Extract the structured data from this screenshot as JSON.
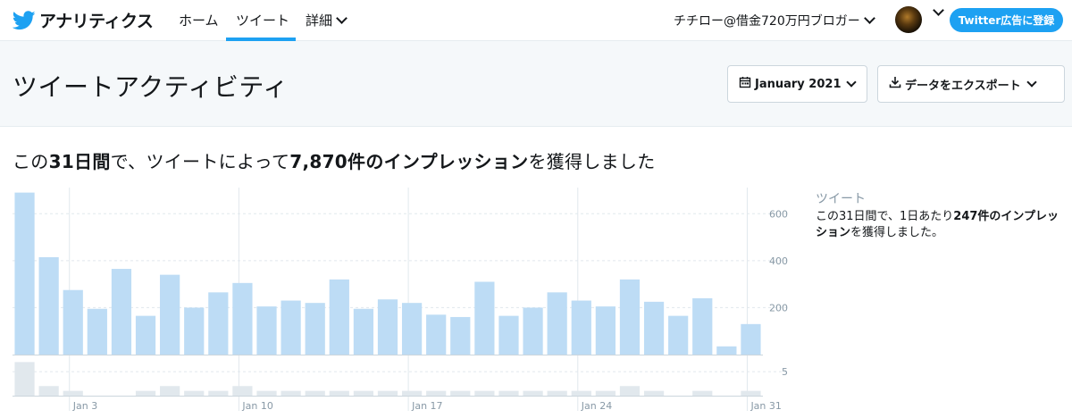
{
  "nav": {
    "brand": "アナリティクス",
    "home": "ホーム",
    "tweets": "ツイート",
    "more": "詳細",
    "account": "チチロー@借金720万円ブロガー",
    "ads_button": "Twitter広告に登録"
  },
  "header": {
    "title": "ツイートアクティビティ",
    "date_button": "January 2021",
    "export_button": "データをエクスポート"
  },
  "summary": {
    "prefix": "この",
    "period": "31日間",
    "mid": "で、ツイートによって",
    "impressions": "7,870件のインプレッション",
    "suffix": "を獲得しました"
  },
  "side_panel": {
    "title": "ツイート",
    "desc_prefix": "この31日間で、1日あたり",
    "desc_bold": "247件のインプレッション",
    "desc_suffix": "を獲得しました。"
  },
  "colors": {
    "accent": "#1da1f2",
    "bar": "#bddcf5",
    "small_bar": "#e1e8ed"
  },
  "chart_data": {
    "type": "bar",
    "categories": [
      "Jan 1",
      "Jan 2",
      "Jan 3",
      "Jan 4",
      "Jan 5",
      "Jan 6",
      "Jan 7",
      "Jan 8",
      "Jan 9",
      "Jan 10",
      "Jan 11",
      "Jan 12",
      "Jan 13",
      "Jan 14",
      "Jan 15",
      "Jan 16",
      "Jan 17",
      "Jan 18",
      "Jan 19",
      "Jan 20",
      "Jan 21",
      "Jan 22",
      "Jan 23",
      "Jan 24",
      "Jan 25",
      "Jan 26",
      "Jan 27",
      "Jan 28",
      "Jan 29",
      "Jan 30",
      "Jan 31"
    ],
    "x_tick_labels": [
      "Jan 3",
      "Jan 10",
      "Jan 17",
      "Jan 24",
      "Jan 31"
    ],
    "x_tick_indices": [
      2,
      9,
      16,
      23,
      30
    ],
    "values": [
      690,
      415,
      275,
      195,
      365,
      165,
      340,
      200,
      265,
      305,
      205,
      230,
      220,
      320,
      195,
      235,
      220,
      170,
      160,
      310,
      165,
      200,
      265,
      230,
      205,
      320,
      225,
      165,
      240,
      35,
      130
    ],
    "ylim": [
      0,
      700
    ],
    "y_ticks": [
      200,
      400,
      600
    ],
    "secondary": {
      "values": [
        7,
        2,
        1,
        0,
        0,
        1,
        2,
        1,
        1,
        2,
        1,
        1,
        1,
        1,
        1,
        1,
        1,
        1,
        1,
        1,
        1,
        1,
        1,
        1,
        1,
        2,
        1,
        0,
        1,
        0,
        1
      ],
      "ylim": [
        0,
        8
      ],
      "y_ticks": [
        5
      ]
    },
    "grid": true
  }
}
